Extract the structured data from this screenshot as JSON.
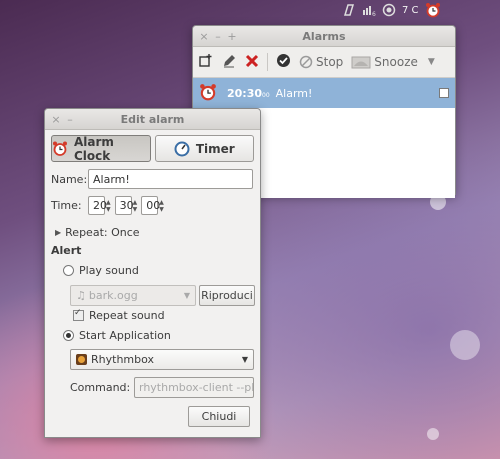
{
  "panel": {
    "temperature": "7 C",
    "icons": [
      "script-icon",
      "battery-icon",
      "weather-icon",
      "alarm-clock-icon"
    ]
  },
  "alarms_window": {
    "title": "Alarms",
    "toolbar": {
      "stop_label": "Stop",
      "snooze_label": "Snooze"
    },
    "alarms": [
      {
        "time": "20:30",
        "seconds": "00",
        "name": "Alarm!",
        "enabled": true
      }
    ]
  },
  "edit_window": {
    "title": "Edit alarm",
    "tabs": [
      {
        "label": "Alarm Clock",
        "active": true
      },
      {
        "label": "Timer",
        "active": false
      }
    ],
    "name_label": "Name:",
    "name_value": "Alarm!",
    "time_label": "Time:",
    "hours": "20",
    "minutes": "30",
    "seconds": "00",
    "repeat_label": "Repeat: Once",
    "alert_heading": "Alert",
    "play_sound_label": "Play sound",
    "sound_file": "bark.ogg",
    "play_button_label": "Riproduci",
    "repeat_sound_label": "Repeat sound",
    "start_app_label": "Start Application",
    "application": "Rhythmbox",
    "command_label": "Command:",
    "command_value": "rhythmbox-client --play",
    "close_button_label": "Chiudi"
  },
  "colors": {
    "selection": "#8fb3d8",
    "delete_red": "#cc2222",
    "alarm_red": "#d43b2a"
  }
}
